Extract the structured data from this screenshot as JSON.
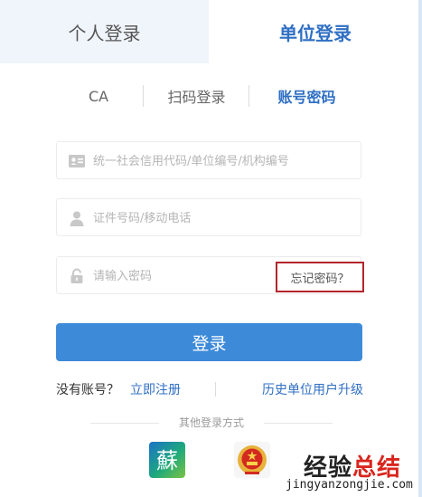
{
  "tabs": {
    "personal": "个人登录",
    "unit": "单位登录"
  },
  "sub_tabs": {
    "ca": "CA",
    "scan": "扫码登录",
    "account": "账号密码"
  },
  "fields": {
    "credit_code": {
      "placeholder": "统一社会信用代码/单位编号/机构编号",
      "icon": "id-card-icon"
    },
    "id_phone": {
      "placeholder": "证件号码/移动电话",
      "icon": "user-icon"
    },
    "password": {
      "placeholder": "请输入密码",
      "icon": "lock-icon"
    }
  },
  "forgot_password": "忘记密码？",
  "login_button": "登录",
  "register_row": {
    "no_account": "没有账号？",
    "register": "立即注册",
    "upgrade": "历史单位用户升级"
  },
  "other_login": "其他登录方式",
  "other_icons": {
    "su": "蘇",
    "gov": "national-emblem-icon"
  },
  "watermark": {
    "title_a": "经验",
    "title_b": "总结",
    "url": "jingyanzongjie.com"
  },
  "colors": {
    "accent": "#2f6fc4",
    "button": "#3d8ad9",
    "highlight_border": "#b3262c",
    "tab_bg": "#f0f5fb"
  }
}
